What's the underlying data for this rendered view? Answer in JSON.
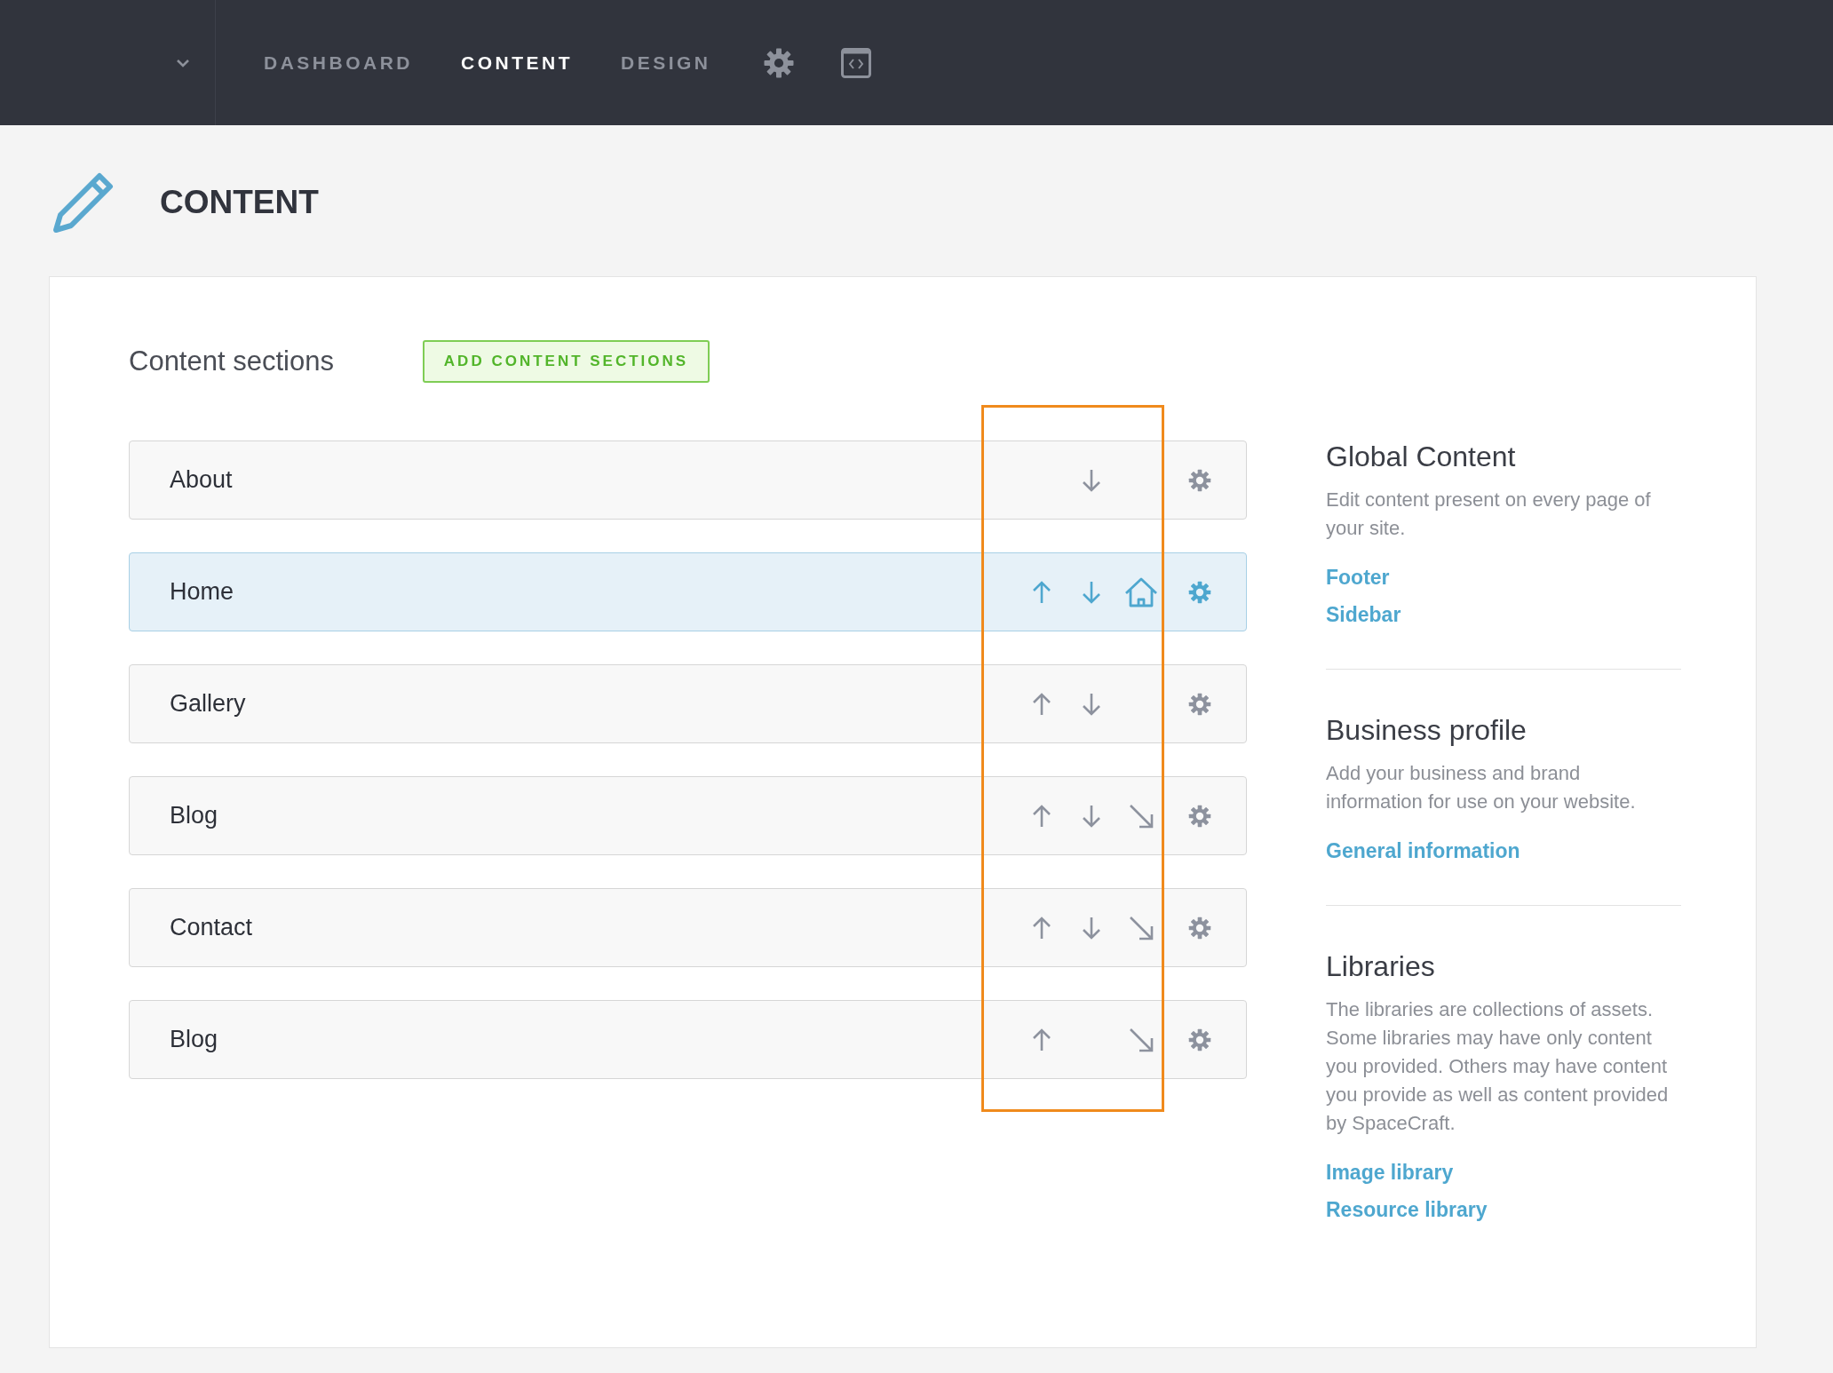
{
  "nav": {
    "items": [
      {
        "label": "DASHBOARD",
        "selected": false
      },
      {
        "label": "CONTENT",
        "selected": true
      },
      {
        "label": "DESIGN",
        "selected": false
      }
    ]
  },
  "page": {
    "title": "CONTENT"
  },
  "sections": {
    "title": "Content sections",
    "add_button": "ADD CONTENT SECTIONS",
    "rows": [
      {
        "label": "About",
        "selected": false,
        "actions": [
          {
            "kind": "down"
          }
        ]
      },
      {
        "label": "Home",
        "selected": true,
        "actions": [
          {
            "kind": "up"
          },
          {
            "kind": "down"
          },
          {
            "kind": "home"
          }
        ]
      },
      {
        "label": "Gallery",
        "selected": false,
        "actions": [
          {
            "kind": "up"
          },
          {
            "kind": "down"
          }
        ]
      },
      {
        "label": "Blog",
        "selected": false,
        "actions": [
          {
            "kind": "up"
          },
          {
            "kind": "down"
          },
          {
            "kind": "link"
          }
        ]
      },
      {
        "label": "Contact",
        "selected": false,
        "actions": [
          {
            "kind": "up"
          },
          {
            "kind": "down"
          },
          {
            "kind": "link"
          }
        ]
      },
      {
        "label": "Blog",
        "selected": false,
        "actions": [
          {
            "kind": "up"
          },
          {
            "kind": "link"
          }
        ]
      }
    ]
  },
  "sidebar": {
    "blocks": [
      {
        "title": "Global Content",
        "description": "Edit content present on every page of your site.",
        "links": [
          "Footer",
          "Sidebar"
        ]
      },
      {
        "title": "Business profile",
        "description": "Add your business and brand information for use on your website.",
        "links": [
          "General information"
        ]
      },
      {
        "title": "Libraries",
        "description": "The libraries are collections of assets. Some libraries may have only content you provided. Others may have content you provide as well as content provided by SpaceCraft.",
        "links": [
          "Image library",
          "Resource library"
        ]
      }
    ]
  }
}
